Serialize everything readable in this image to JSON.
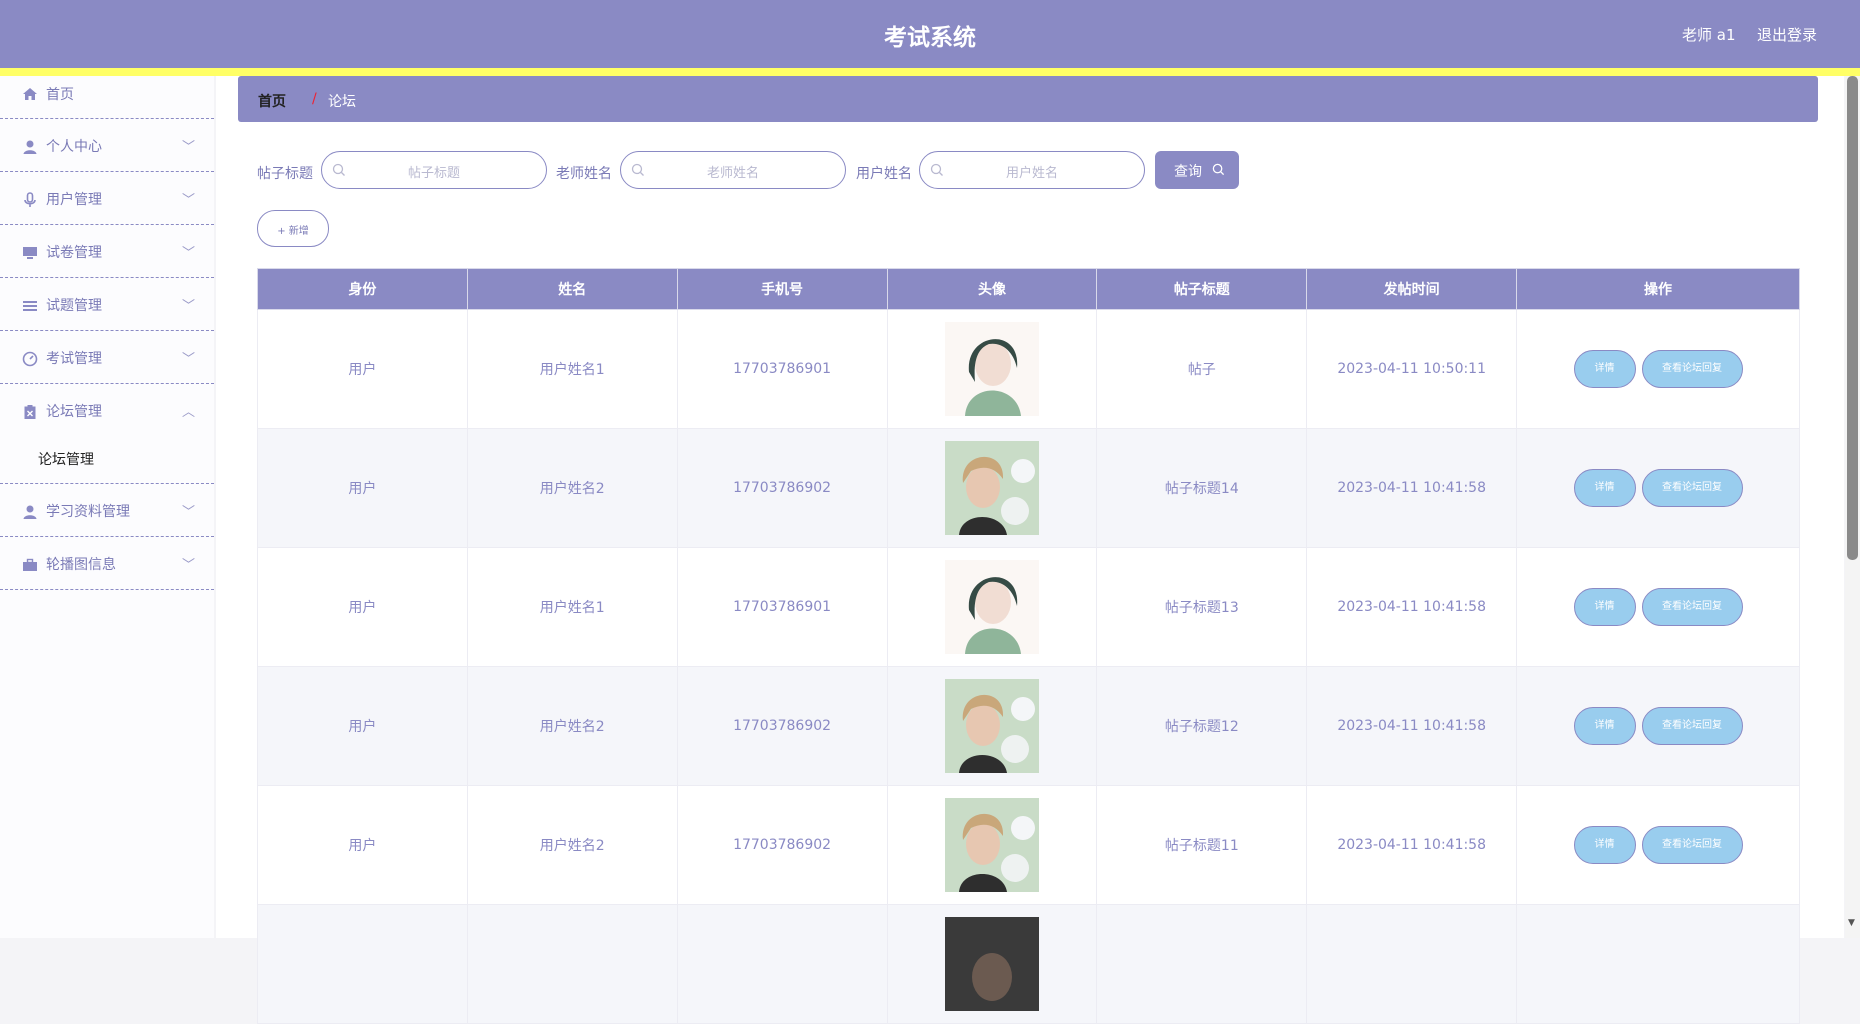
{
  "header": {
    "title": "考试系统",
    "user": "老师 a1",
    "logout": "退出登录"
  },
  "sidebar": {
    "items": [
      {
        "label": "首页",
        "icon": "home-icon"
      },
      {
        "label": "个人中心",
        "icon": "user-icon"
      },
      {
        "label": "用户管理",
        "icon": "microphone-icon"
      },
      {
        "label": "试卷管理",
        "icon": "monitor-icon"
      },
      {
        "label": "试题管理",
        "icon": "list-icon"
      },
      {
        "label": "考试管理",
        "icon": "gauge-icon"
      },
      {
        "label": "论坛管理",
        "icon": "clipboard-icon"
      },
      {
        "label": "学习资料管理",
        "icon": "user-icon"
      },
      {
        "label": "轮播图信息",
        "icon": "briefcase-icon"
      }
    ],
    "sub_item": "论坛管理"
  },
  "breadcrumb": {
    "home": "首页",
    "separator": "/",
    "current": "论坛"
  },
  "filters": [
    {
      "label": "帖子标题",
      "placeholder": "帖子标题"
    },
    {
      "label": "老师姓名",
      "placeholder": "老师姓名"
    },
    {
      "label": "用户姓名",
      "placeholder": "用户姓名"
    }
  ],
  "query_button": "查询",
  "add_button": "+ 新增",
  "table": {
    "headers": [
      "身份",
      "姓名",
      "手机号",
      "头像",
      "帖子标题",
      "发帖时间",
      "操作"
    ],
    "rows": [
      {
        "role": "用户",
        "name": "用户姓名1",
        "phone": "17703786901",
        "avatar": "woman-portrait",
        "title": "帖子",
        "time": "2023-04-11 10:50:11"
      },
      {
        "role": "用户",
        "name": "用户姓名2",
        "phone": "17703786902",
        "avatar": "man-portrait",
        "title": "帖子标题14",
        "time": "2023-04-11 10:41:58"
      },
      {
        "role": "用户",
        "name": "用户姓名1",
        "phone": "17703786901",
        "avatar": "woman-portrait",
        "title": "帖子标题13",
        "time": "2023-04-11 10:41:58"
      },
      {
        "role": "用户",
        "name": "用户姓名2",
        "phone": "17703786902",
        "avatar": "man-portrait",
        "title": "帖子标题12",
        "time": "2023-04-11 10:41:58"
      },
      {
        "role": "用户",
        "name": "用户姓名2",
        "phone": "17703786902",
        "avatar": "man-portrait",
        "title": "帖子标题11",
        "time": "2023-04-11 10:41:58"
      }
    ],
    "detail_button": "详情",
    "reply_button": "查看论坛回复"
  },
  "colors": {
    "accent": "#8a8ac4",
    "stripe": "#ffff66",
    "action_button": "#99cdee"
  }
}
